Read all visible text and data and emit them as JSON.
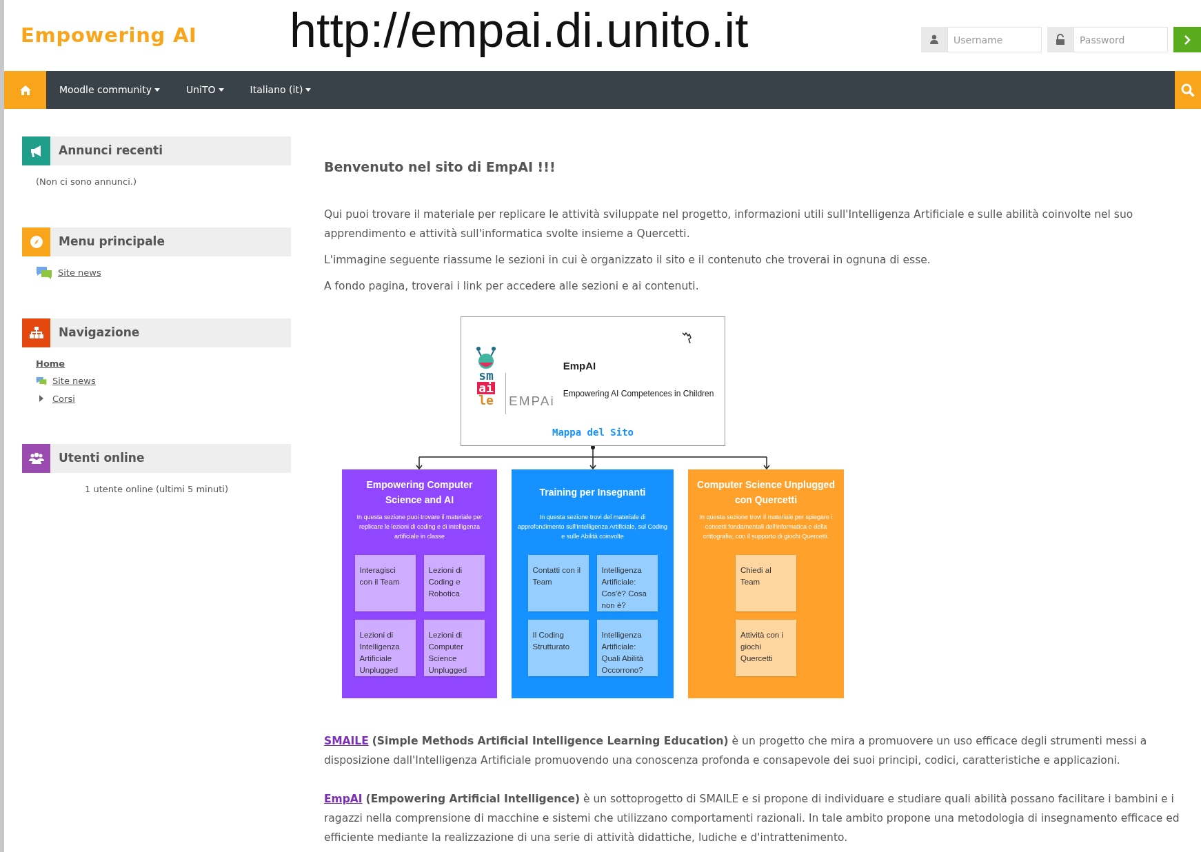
{
  "header": {
    "logo": "Empowering AI",
    "url_overlay": "http://empai.di.unito.it",
    "login": {
      "username_placeholder": "Username",
      "password_placeholder": "Password"
    }
  },
  "nav": {
    "items": [
      {
        "label": "Moodle community",
        "kind": "dropdown"
      },
      {
        "label": "UniTO",
        "kind": "dropdown"
      },
      {
        "label": "Italiano (it)",
        "kind": "dropdown"
      }
    ]
  },
  "sidebar": {
    "blocks": [
      {
        "title": "Annunci recenti",
        "color": "#1f9e8c",
        "kind": "text",
        "text": "(Non ci sono annunci.)"
      },
      {
        "title": "Menu principale",
        "color": "#f9a51b",
        "kind": "links",
        "links": [
          {
            "label": "Site news"
          }
        ]
      },
      {
        "title": "Navigazione",
        "color": "#e5480f",
        "kind": "tree",
        "items": [
          {
            "label": "Home",
            "kind": "plain"
          },
          {
            "label": "Site news",
            "kind": "forum"
          },
          {
            "label": "Corsi",
            "kind": "branch",
            "expanded": false
          }
        ]
      },
      {
        "title": "Utenti online",
        "color": "#9b4ab0",
        "kind": "centered",
        "text": "1 utente online (ultimi 5 minuti)"
      }
    ]
  },
  "main": {
    "heading": "Benvenuto nel sito di EmpAI !!!",
    "paragraphs": [
      "Qui puoi trovare il materiale per replicare le attività sviluppate nel progetto, informazioni utili sull'Intelligenza Artificiale e sulle abilità coinvolte nel suo apprendimento e attività sull'informatica svolte insieme a Quercetti.",
      "L'immagine seguente riassume le sezioni in cui è organizzato il sito e il contenuto che troverai in ognuna di esse.",
      "A fondo pagina, troverai i link per accedere alle sezioni e ai contenuti."
    ],
    "diagram": {
      "logo_rows": [
        "sm",
        "ai",
        "le"
      ],
      "logo_word": "EMPAi",
      "title": "EmpAI",
      "subtitle": "Empowering AI Competences in Children",
      "map_link": "Mappa del Sito",
      "sections": [
        {
          "title": "Empowering Computer Science and AI",
          "description": "In questa sezione puoi trovare il materiale per replicare le lezioni di coding e di intelligenza artificiale in classe",
          "color": "#9146ff",
          "boxes": [
            "Interagisci con il Team",
            "Lezioni di Coding e Robotica",
            "Lezioni di Intelligenza Artificiale Unplugged",
            "Lezioni di Computer Science Unplugged"
          ]
        },
        {
          "title": "Training per Insegnanti",
          "description": "In questa sezione trovi del materiale di approfondimento sull'Intelligenza Artificiale, sul Coding e sulle Abilità coinvolte",
          "color": "#1592ff",
          "boxes": [
            "Contatti con il Team",
            "Intelligenza Artificiale: Cos'è? Cosa non è?",
            "Il Coding Strutturato",
            "Intelligenza Artificiale: Quali Abilità Occorrono?"
          ]
        },
        {
          "title": "Computer Science Unplugged con Quercetti",
          "description": "In questa sezione trovi il materiale per  spiegare i concetti fondamentali dell'informatica e della crittografia, con il supporto di giochi Quercetti.",
          "color": "#ffa12b",
          "boxes": [
            "Chiedi al Team",
            "Attività con i giochi Quercetti"
          ]
        }
      ]
    },
    "projects": [
      {
        "link": "SMAILE",
        "text": " **(Simple Methods Artificial Intelligence Learning Education)** è un progetto che mira a promuovere un uso efficace degli strumenti messi a disposizione dall'Intelligenza Artificiale promuovendo una conoscenza profonda e consapevole dei suoi principi, codici, caratteristiche e applicazioni."
      },
      {
        "link": "EmpAI",
        "text": " **(Empowering Artificial Intelligence)** è un sottoprogetto di SMAILE e si propone di individuare e studiare quali abilità possano facilitare i bambini e i ragazzi nella comprensione di macchine e sistemi che utilizzano comportamenti razionali. In tale ambito propone una metodologia di insegnamento efficace ed efficiente mediante la realizzazione di una serie di attività didattiche, ludiche e d'intrattenimento."
      }
    ]
  }
}
